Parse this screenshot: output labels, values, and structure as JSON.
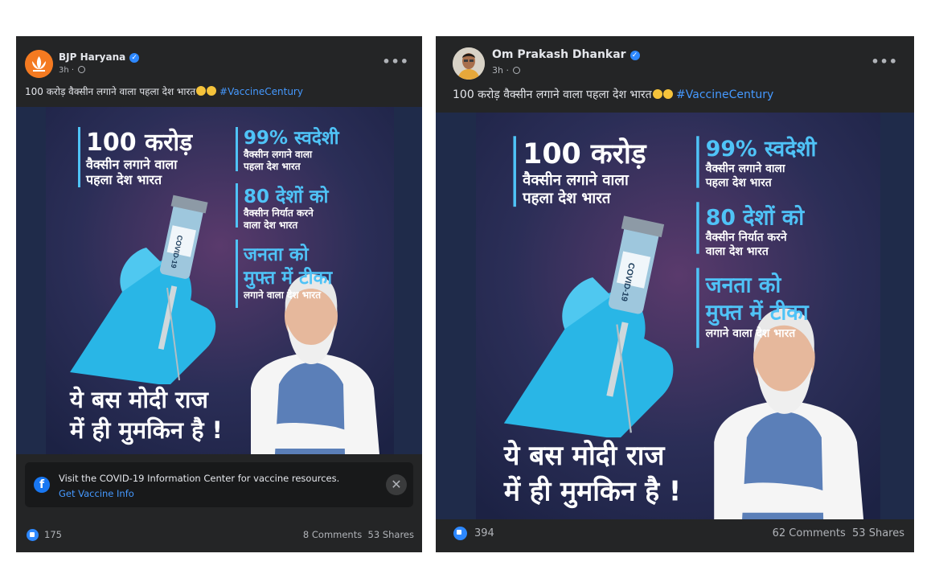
{
  "posts": [
    {
      "author": "BJP Haryana",
      "time": "3h",
      "caption": "100 करोड़ वैक्सीन लगाने वाला पहला देश भारत",
      "hashtag": "#VaccineCentury",
      "poster": {
        "headline1_big": "100 करोड़",
        "headline1_sub1": "वैक्सीन लगाने वाला",
        "headline1_sub2": "पहला देश भारत",
        "headline2_big": "99% स्वदेशी",
        "headline2_sub1": "वैक्सीन लगाने वाला",
        "headline2_sub2": "पहला देश भारत",
        "headline3_big": "80 देशों को",
        "headline3_sub1": "वैक्सीन निर्यात करने",
        "headline3_sub2": "वाला देश भारत",
        "headline4_big1": "जनता को",
        "headline4_big2": "मुफ्त में टीका",
        "headline4_sub": "लगाने वाला देश भारत",
        "slogan1": "ये बस मोदी राज",
        "slogan2": "में ही मुमकिन है !",
        "vial_label": "COVID-19"
      },
      "info_center": {
        "text": "Visit the COVID-19 Information Center for vaccine resources.",
        "link": "Get Vaccine Info",
        "close": "✕"
      },
      "likes": "175",
      "comments": "8 Comments",
      "shares": "53 Shares"
    },
    {
      "author": "Om Prakash Dhankar",
      "time": "3h",
      "caption": "100 करोड़ वैक्सीन लगाने वाला पहला देश भारत",
      "hashtag": "#VaccineCentury",
      "poster": {
        "headline1_big": "100 करोड़",
        "headline1_sub1": "वैक्सीन लगाने वाला",
        "headline1_sub2": "पहला देश भारत",
        "headline2_big": "99% स्वदेशी",
        "headline2_sub1": "वैक्सीन लगाने वाला",
        "headline2_sub2": "पहला देश भारत",
        "headline3_big": "80 देशों को",
        "headline3_sub1": "वैक्सीन निर्यात करने",
        "headline3_sub2": "वाला देश भारत",
        "headline4_big1": "जनता को",
        "headline4_big2": "मुफ्त में टीका",
        "headline4_sub": "लगाने वाला देश भारत",
        "slogan1": "ये बस मोदी राज",
        "slogan2": "में ही मुमकिन है !",
        "vial_label": "COVID-19"
      },
      "likes": "394",
      "comments": "62 Comments",
      "shares": "53 Shares"
    }
  ],
  "ui": {
    "more_label": "•••",
    "verified_glyph": "✓",
    "fb_glyph": "f"
  }
}
